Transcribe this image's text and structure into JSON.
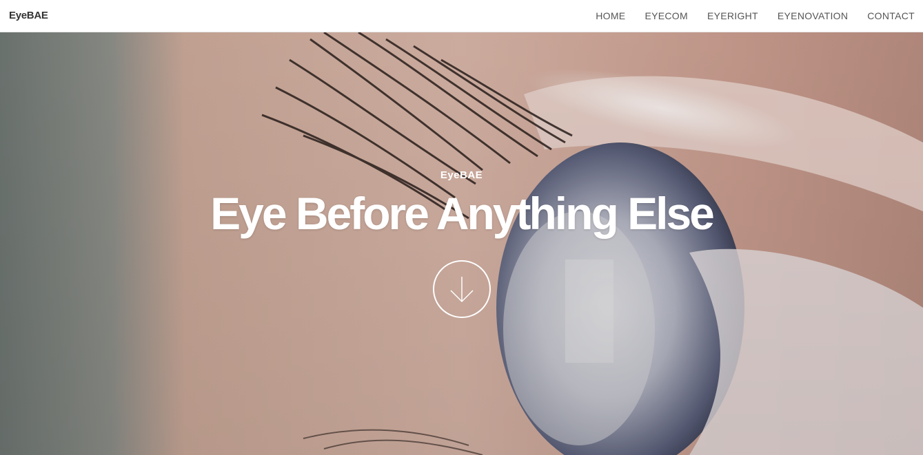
{
  "navbar": {
    "brand": "EyeBAE",
    "items": [
      {
        "label": "HOME"
      },
      {
        "label": "EYECOM"
      },
      {
        "label": "EYERIGHT"
      },
      {
        "label": "EYENOVATION"
      },
      {
        "label": "CONTACT"
      }
    ]
  },
  "hero": {
    "eyebrow": "EyeBAE",
    "headline": "Eye Before Anything Else",
    "scroll_icon": "arrow-down-icon"
  },
  "colors": {
    "nav_background": "#ffffff",
    "nav_text": "#555555",
    "brand_text": "#333333",
    "hero_text": "#ffffff"
  }
}
